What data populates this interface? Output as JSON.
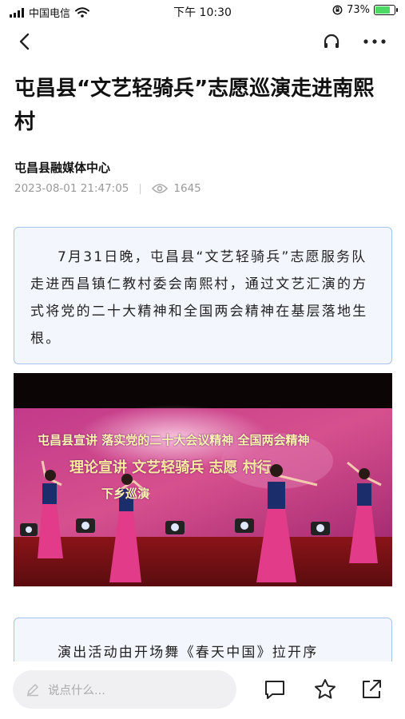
{
  "status_bar": {
    "carrier": "中国电信",
    "time": "下午 10:30",
    "battery": "73%",
    "battery_level": 0.73
  },
  "nav": {
    "back_icon": "chevron-left-icon",
    "listen_icon": "headphones-icon",
    "more_icon": "more-horizontal-icon"
  },
  "article": {
    "title": "屯昌县“文艺轻骑兵”志愿巡演走进南熙村",
    "source": "屯昌县融媒体中心",
    "datetime": "2023-08-01 21:47:05",
    "views": "1645",
    "summary": "7月31日晚，屯昌县“文艺轻骑兵”志愿服务队走进西昌镇仁教村委会南熙村，通过文艺汇演的方式将党的二十大精神和全国两会精神在基层落地生根。",
    "photo_banner": {
      "line1": "屯昌县宣讲 落实党的二十大会议精神 全国两会精神",
      "line2": "理论宣讲 文艺轻骑兵 志愿 村行",
      "line3": "下乡巡演"
    },
    "paragraph2": "演出活动由开场舞《春天中国》拉开序"
  },
  "bottom_bar": {
    "comment_placeholder": "说点什么...",
    "icons": [
      "comment-icon",
      "star-icon",
      "share-icon"
    ]
  },
  "colors": {
    "card_border": "#a9c3ec",
    "card_bg": "#f3f7fd",
    "battery_green": "#4cd964"
  }
}
